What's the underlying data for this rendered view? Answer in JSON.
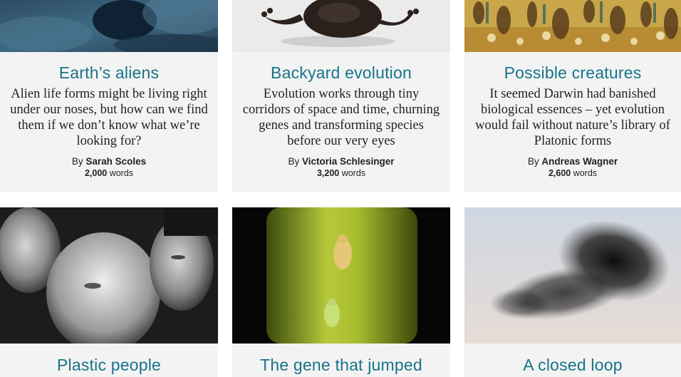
{
  "articles": [
    {
      "title": "Earth’s aliens",
      "description": "Alien life forms might be living right under our noses, but how can we find them if we don’t know what we’re looking for?",
      "by": "By",
      "author": "Sarah Scoles",
      "word_count": "2,000",
      "words_label": "words",
      "image": "underwater-rock-image"
    },
    {
      "title": "Backyard evolution",
      "description": "Evolution works through tiny corridors of space and time, churning genes and transforming species before our very eyes",
      "by": "By",
      "author": "Victoria Schlesinger",
      "word_count": "3,200",
      "words_label": "words",
      "image": "salamander-image"
    },
    {
      "title": "Possible creatures",
      "description": "It seemed Darwin had banished biological essences – yet evolution would fail without nature’s library of Platonic forms",
      "by": "By",
      "author": "Andreas Wagner",
      "word_count": "2,600",
      "words_label": "words",
      "image": "illustrated-creatures-image"
    },
    {
      "title": "Plastic people",
      "image": "mannequin-faces-image"
    },
    {
      "title": "The gene that jumped",
      "image": "aphids-on-stem-image"
    },
    {
      "title": "A closed loop",
      "image": "starling-murmuration-image"
    }
  ]
}
